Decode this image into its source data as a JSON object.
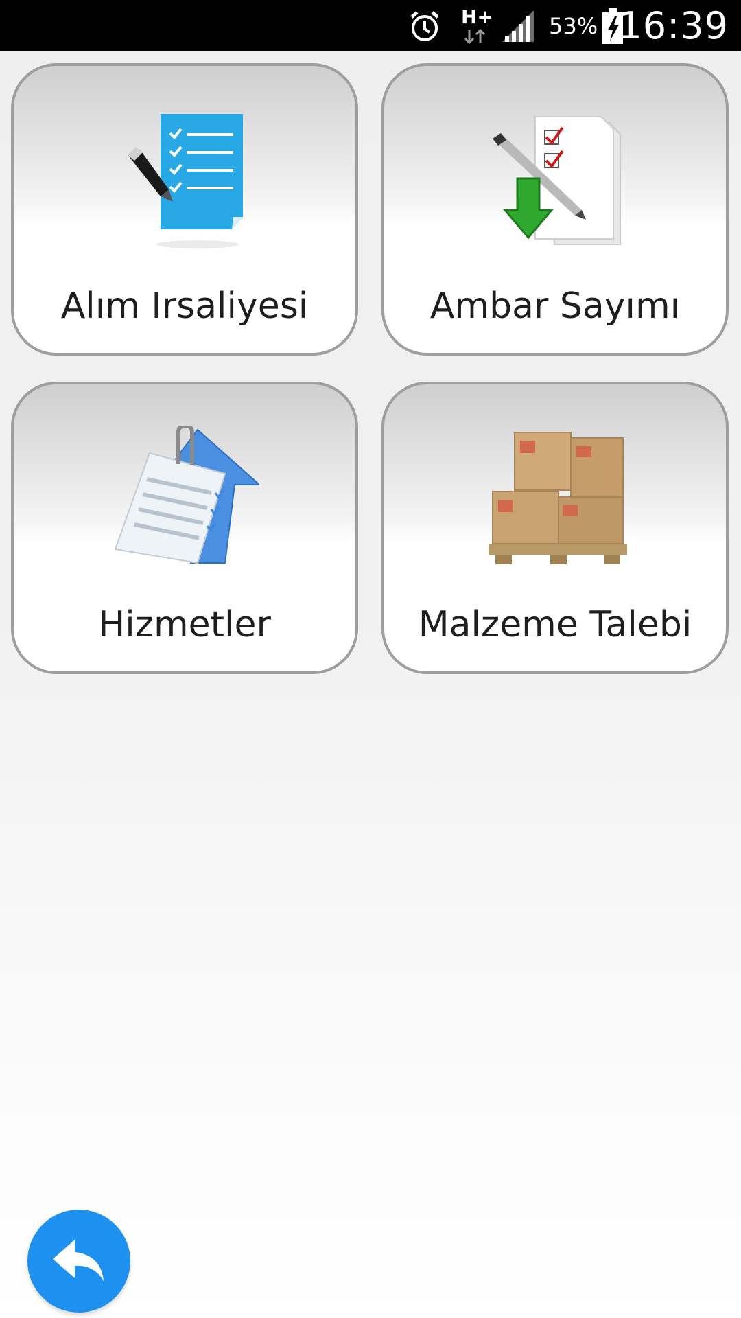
{
  "status_bar": {
    "time": "16:39",
    "battery_percent": "53%",
    "network_type": "H+",
    "icons": [
      "alarm-icon",
      "network-h-plus-icon",
      "signal-icon",
      "battery-charging-icon"
    ]
  },
  "menu": {
    "items": [
      {
        "label": "Alım Irsaliyesi",
        "icon": "checklist-document-icon"
      },
      {
        "label": "Ambar Sayımı",
        "icon": "inventory-count-icon"
      },
      {
        "label": "Hizmetler",
        "icon": "services-document-icon"
      },
      {
        "label": "Malzeme Talebi",
        "icon": "boxes-pallet-icon"
      }
    ]
  },
  "back_button": {
    "icon": "reply-back-icon"
  },
  "colors": {
    "fab": "#1e90f0",
    "card_border": "#9e9e9e",
    "status_bar": "#000000"
  }
}
